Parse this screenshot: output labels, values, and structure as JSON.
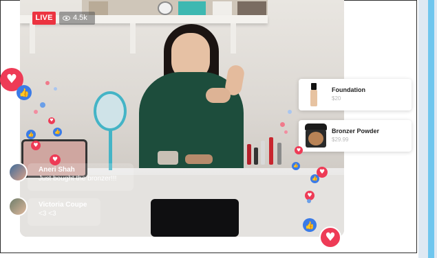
{
  "live_badge": "LIVE",
  "view_count": "4.5k",
  "comments": [
    {
      "name": "Aneri Shah",
      "text": "Just bought the bronzer!!!"
    },
    {
      "name": "Victoria Coupe",
      "text": "<3 <3"
    }
  ],
  "products": [
    {
      "name": "Foundation",
      "price": "$20"
    },
    {
      "name": "Bronzer Powder",
      "price": "$29.99"
    }
  ],
  "icons": {
    "heart": "heart-icon",
    "like": "thumbs-up-icon",
    "eye": "eye-icon"
  },
  "colors": {
    "live": "#ec3340",
    "heart": "#ee3b56",
    "like": "#3b7be6",
    "accent_strip": "#6fc6ee"
  }
}
